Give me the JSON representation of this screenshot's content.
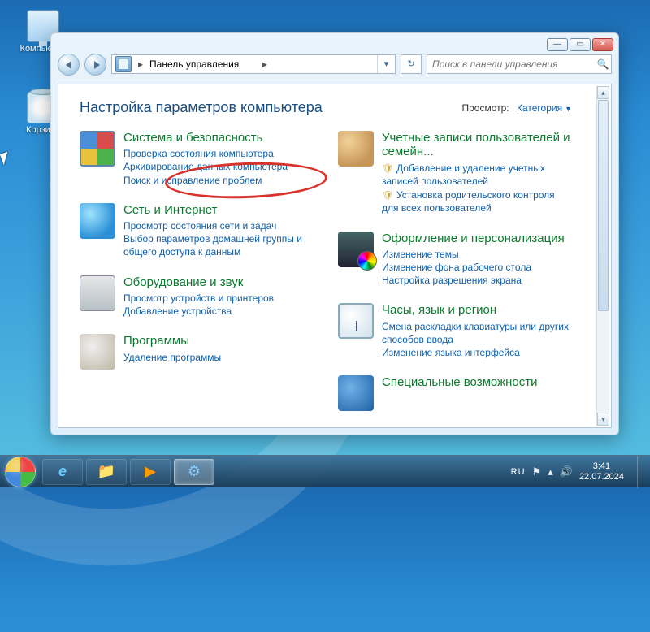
{
  "desktop": {
    "icons": [
      {
        "name": "computer",
        "label": "Компьютер"
      },
      {
        "name": "recycle-bin",
        "label": "Корзина"
      }
    ]
  },
  "window": {
    "titlebar_buttons": {
      "min": "—",
      "max": "▭",
      "close": "✕"
    },
    "breadcrumb": {
      "root": "Панель управления",
      "separator": "▸"
    },
    "search_placeholder": "Поиск в панели управления",
    "heading": "Настройка параметров компьютера",
    "view": {
      "label": "Просмотр:",
      "value": "Категория"
    },
    "categories_left": [
      {
        "icon": "system",
        "title": "Система и безопасность",
        "links": [
          {
            "text": "Проверка состояния компьютера",
            "shield": false
          },
          {
            "text": "Архивирование данных компьютера",
            "shield": false
          },
          {
            "text": "Поиск и исправление проблем",
            "shield": false
          }
        ]
      },
      {
        "icon": "network",
        "title": "Сеть и Интернет",
        "links": [
          {
            "text": "Просмотр состояния сети и задач",
            "shield": false
          },
          {
            "text": "Выбор параметров домашней группы и общего доступа к данным",
            "shield": false
          }
        ]
      },
      {
        "icon": "hardware",
        "title": "Оборудование и звук",
        "links": [
          {
            "text": "Просмотр устройств и принтеров",
            "shield": false
          },
          {
            "text": "Добавление устройства",
            "shield": false
          }
        ]
      },
      {
        "icon": "programs",
        "title": "Программы",
        "links": [
          {
            "text": "Удаление программы",
            "shield": false
          }
        ]
      }
    ],
    "categories_right": [
      {
        "icon": "users",
        "title": "Учетные записи пользователей и семейн...",
        "links": [
          {
            "text": "Добавление и удаление учетных записей пользователей",
            "shield": true
          },
          {
            "text": "Установка родительского контроля для всех пользователей",
            "shield": true
          }
        ]
      },
      {
        "icon": "appearance",
        "title": "Оформление и персонализация",
        "links": [
          {
            "text": "Изменение темы",
            "shield": false
          },
          {
            "text": "Изменение фона рабочего стола",
            "shield": false
          },
          {
            "text": "Настройка разрешения экрана",
            "shield": false
          }
        ]
      },
      {
        "icon": "clock",
        "title": "Часы, язык и регион",
        "links": [
          {
            "text": "Смена раскладки клавиатуры или других способов ввода",
            "shield": false
          },
          {
            "text": "Изменение языка интерфейса",
            "shield": false
          }
        ]
      },
      {
        "icon": "access",
        "title": "Специальные возможности",
        "links": []
      }
    ]
  },
  "annotation": {
    "highlighted_category": "Система и безопасность"
  },
  "taskbar": {
    "pinned": [
      {
        "name": "internet-explorer",
        "glyph": "e",
        "active": false
      },
      {
        "name": "file-explorer",
        "glyph": "📁",
        "active": false
      },
      {
        "name": "media-player",
        "glyph": "▶",
        "active": false
      },
      {
        "name": "control-panel",
        "glyph": "⚙",
        "active": true
      }
    ],
    "language": "RU",
    "tray_icons": [
      "flag-icon",
      "chevron-up-icon",
      "speaker-icon"
    ],
    "time": "3:41",
    "date": "22.07.2024"
  }
}
